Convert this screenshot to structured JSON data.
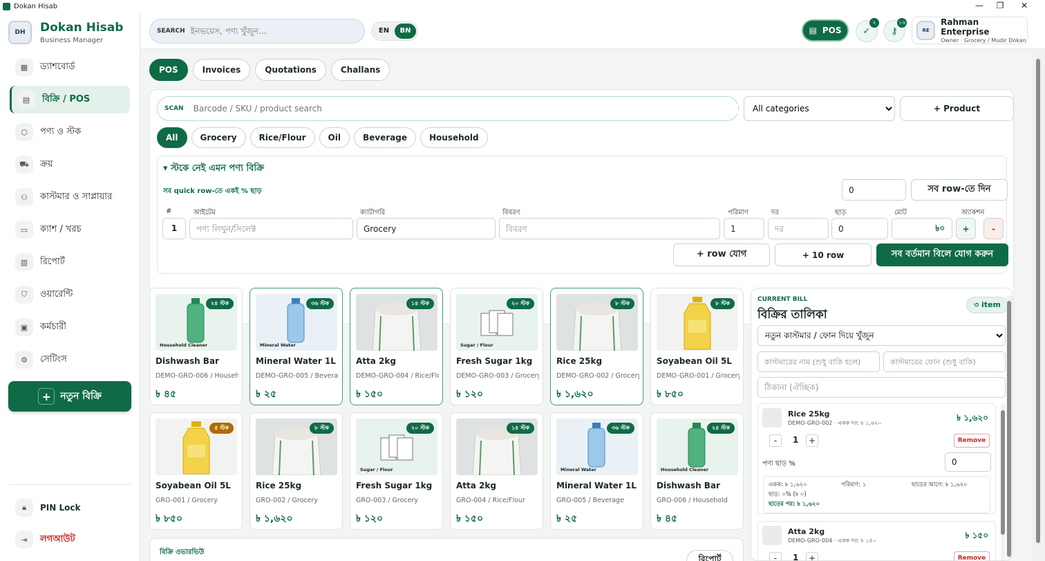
{
  "window": {
    "title": "Dokan Hisab"
  },
  "brand": {
    "name": "Dokan Hisab",
    "subtitle": "Business Manager"
  },
  "sidebar": {
    "items": [
      {
        "label": "ড্যাশবোর্ড",
        "icon": "dashboard-icon"
      },
      {
        "label": "বিক্রি / POS",
        "icon": "receipt-icon"
      },
      {
        "label": "পণ্য ও স্টক",
        "icon": "box-icon"
      },
      {
        "label": "ক্রয়",
        "icon": "truck-icon"
      },
      {
        "label": "কাস্টমার ও সাপ্লায়ার",
        "icon": "users-icon"
      },
      {
        "label": "ক্যাশ / খরচ",
        "icon": "wallet-icon"
      },
      {
        "label": "রিপোর্ট",
        "icon": "chart-icon"
      },
      {
        "label": "ওয়ারেন্টি",
        "icon": "shield-icon"
      },
      {
        "label": "কর্মচারী",
        "icon": "calendar-icon"
      },
      {
        "label": "সেটিংস",
        "icon": "settings-icon"
      }
    ],
    "new_sale": "নতুন বিক্রি",
    "pin_lock": "PIN Lock",
    "logout": "লগআউট"
  },
  "topbar": {
    "search_label": "SEARCH",
    "search_placeholder": "ইনভয়েস, পণ্য খুঁজুন...",
    "lang_en": "EN",
    "lang_bn": "BN",
    "pos_label": "POS",
    "badge1": "২",
    "badge2": "১৬",
    "business_name": "Rahman Enterprise",
    "business_sub": "Owner · Grocery / Mudir Dokan"
  },
  "tabs": [
    "POS",
    "Invoices",
    "Quotations",
    "Challans"
  ],
  "scan": {
    "label": "SCAN",
    "placeholder": "Barcode / SKU / product search",
    "category_value": "All categories",
    "add_product": "+ Product"
  },
  "chips": [
    "All",
    "Grocery",
    "Rice/Flour",
    "Oil",
    "Beverage",
    "Household"
  ],
  "oos": {
    "title": "▾ স্টকে নেই এমন পণ্য বিক্রি",
    "note": "সব quick row-তে একই % ছাড়",
    "bulk_value": "0",
    "apply_all": "সব row-তে দিন",
    "headers": [
      "#",
      "আইটেম",
      "ক্যাটাগরি",
      "বিবরণ",
      "পরিমাণ",
      "দর",
      "ছাড়",
      "মোট",
      "অ্যাকশন"
    ],
    "row": {
      "num": "1",
      "item_placeholder": "পণ্য লিখুন/সিলেক্ট",
      "category": "Grocery",
      "desc_placeholder": "বিবরণ",
      "qty": "1",
      "rate_placeholder": "দর",
      "discount": "0",
      "total": "৳০"
    },
    "add_row": "+ row যোগ",
    "add_10": "+ 10 row",
    "add_all": "সব বর্তমান বিলে যোগ করুন"
  },
  "products": [
    {
      "name": "Dishwash Bar",
      "sku": "DEMO-GRO-006 / Household",
      "price": "৳ ৪৫",
      "stock": "২৪ স্টক",
      "kind": "bottle-green",
      "caption": "Household Cleaner"
    },
    {
      "name": "Mineral Water 1L",
      "sku": "DEMO-GRO-005 / Beverage",
      "price": "৳ ২৫",
      "stock": "৩৬ স্টক",
      "kind": "bottle-blue",
      "caption": "Mineral Water"
    },
    {
      "name": "Atta 2kg",
      "sku": "DEMO-GRO-004 / Rice/Flour",
      "price": "৳ ১৫০",
      "stock": "১৪ স্টক",
      "kind": "sack",
      "caption": ""
    },
    {
      "name": "Fresh Sugar 1kg",
      "sku": "DEMO-GRO-003 / Grocery",
      "price": "৳ ১২০",
      "stock": "২০ স্টক",
      "kind": "sugar",
      "caption": "Sugar / Flour"
    },
    {
      "name": "Rice 25kg",
      "sku": "DEMO-GRO-002 / Grocery",
      "price": "৳ ১,৬২০",
      "stock": "৮ স্টক",
      "kind": "sack",
      "caption": ""
    },
    {
      "name": "Soyabean Oil 5L",
      "sku": "DEMO-GRO-001 / Grocery",
      "price": "৳ ৮৫০",
      "stock": "৮ স্টক",
      "kind": "oil",
      "caption": ""
    },
    {
      "name": "Soyabean Oil 5L",
      "sku": "GRO-001 / Grocery",
      "price": "৳ ৮৫০",
      "stock": "৫ স্টক",
      "kind": "oil",
      "caption": ""
    },
    {
      "name": "Rice 25kg",
      "sku": "GRO-002 / Grocery",
      "price": "৳ ১,৬২০",
      "stock": "৮ স্টক",
      "kind": "sack",
      "caption": ""
    },
    {
      "name": "Fresh Sugar 1kg",
      "sku": "GRO-003 / Grocery",
      "price": "৳ ১২০",
      "stock": "২০ স্টক",
      "kind": "sugar",
      "caption": "Sugar / Flour"
    },
    {
      "name": "Atta 2kg",
      "sku": "GRO-004 / Rice/Flour",
      "price": "৳ ১৫০",
      "stock": "১৪ স্টক",
      "kind": "sack",
      "caption": ""
    },
    {
      "name": "Mineral Water 1L",
      "sku": "GRO-005 / Beverage",
      "price": "৳ ২৫",
      "stock": "৩৬ স্টক",
      "kind": "bottle-blue",
      "caption": "Mineral Water"
    },
    {
      "name": "Dishwash Bar",
      "sku": "GRO-006 / Household",
      "price": "৳ ৪৫",
      "stock": "২৪ স্টক",
      "kind": "bottle-green",
      "caption": "Household Cleaner"
    }
  ],
  "bill": {
    "label": "CURRENT BILL",
    "title": "বিক্রির তালিকা",
    "count": "৩ item",
    "customer_select": "নতুন কাস্টমার / ফোন দিয়ে খুঁজুন",
    "name_placeholder": "কাস্টমারের নাম (শুধু বাকি হলে)",
    "phone_placeholder": "কাস্টমারের ফোন (শুধু বাকি)",
    "address_placeholder": "ঠিকানা (ঐচ্ছিক)",
    "items": [
      {
        "name": "Rice 25kg",
        "sub": "DEMO-GRO-002 · একক দর: ৳ ১,৬২০",
        "price": "৳ ১,৬২০",
        "qty": "1",
        "remove": "Remove",
        "discount_label": "পণ্য ছাড় %",
        "discount_value": "0",
        "unit": "একক: ৳ ১,৬২০",
        "qty_text": "পরিমাণ: ১",
        "before": "ছাড়ের আগে: ৳ ১,৬২০",
        "disc": "ছাড়: ০% (৳ ০)",
        "after": "ছাড়ের পর: ৳ ১,৬২০"
      },
      {
        "name": "Atta 2kg",
        "sub": "DEMO-GRO-004 · একক দর: ৳ ১৫০",
        "price": "৳ ১৫০",
        "qty": "1",
        "remove": "Remove"
      }
    ]
  },
  "overview": {
    "label": "বিক্রি ওভারভিউ",
    "report": "রিপোর্ট"
  }
}
